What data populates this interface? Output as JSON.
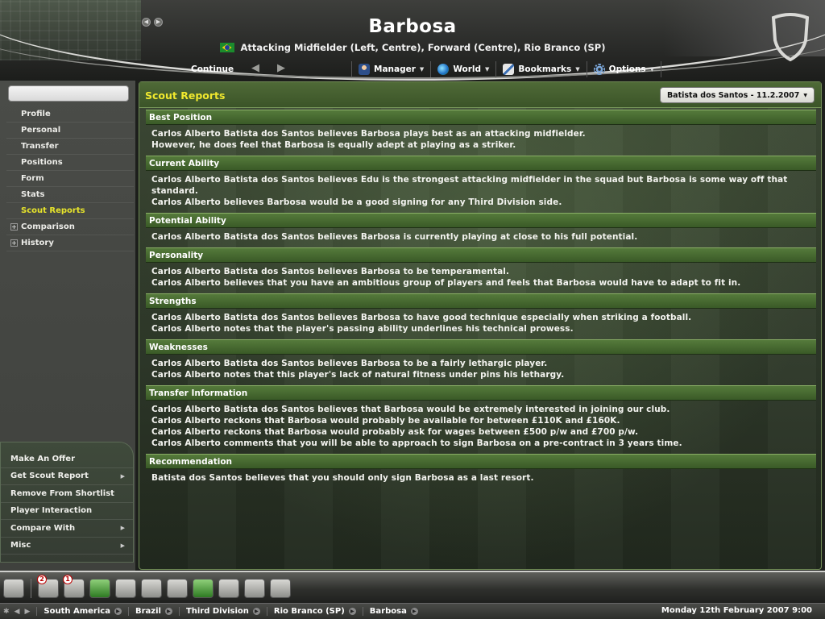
{
  "header": {
    "player_name": "Barbosa",
    "player_description": "Attacking Midfielder (Left, Centre), Forward (Centre), Rio Branco (SP)",
    "continue_label": "Continue",
    "menu": [
      {
        "label": "Manager",
        "icon": "manager-icon"
      },
      {
        "label": "World",
        "icon": "globe-icon"
      },
      {
        "label": "Bookmarks",
        "icon": "bookmark-icon"
      },
      {
        "label": "Options",
        "icon": "gear-icon"
      }
    ]
  },
  "sidebar": {
    "search_value": "",
    "items": [
      {
        "label": "Profile"
      },
      {
        "label": "Personal"
      },
      {
        "label": "Transfer"
      },
      {
        "label": "Positions"
      },
      {
        "label": "Form"
      },
      {
        "label": "Stats"
      },
      {
        "label": "Scout Reports"
      },
      {
        "label": "Comparison"
      },
      {
        "label": "History"
      }
    ],
    "actions": [
      {
        "label": "Make An Offer"
      },
      {
        "label": "Get Scout Report"
      },
      {
        "label": "Remove From Shortlist"
      },
      {
        "label": "Player Interaction"
      },
      {
        "label": "Compare With"
      },
      {
        "label": "Misc"
      }
    ]
  },
  "main": {
    "title": "Scout Reports",
    "scout_selector": "Batista dos Santos - 11.2.2007",
    "sections": [
      {
        "heading": "Best Position",
        "lines": [
          "Carlos Alberto Batista dos Santos believes Barbosa plays best as an attacking midfielder.",
          "However, he does feel that Barbosa is equally adept at playing as a striker."
        ]
      },
      {
        "heading": "Current Ability",
        "lines": [
          "Carlos Alberto Batista dos Santos believes Edu is the strongest attacking midfielder in the squad but Barbosa is some way off that standard.",
          "Carlos Alberto believes Barbosa would be a good signing for any Third Division side."
        ]
      },
      {
        "heading": "Potential Ability",
        "lines": [
          "Carlos Alberto Batista dos Santos believes Barbosa is currently playing at close to his full potential."
        ]
      },
      {
        "heading": "Personality",
        "lines": [
          "Carlos Alberto Batista dos Santos believes Barbosa to be temperamental.",
          "Carlos Alberto believes that you have an ambitious group of players and feels that Barbosa would have to adapt to fit in."
        ]
      },
      {
        "heading": "Strengths",
        "lines": [
          "Carlos Alberto Batista dos Santos believes Barbosa to have good technique especially when striking a football.",
          "Carlos Alberto notes that the player's passing ability underlines his technical prowess."
        ]
      },
      {
        "heading": "Weaknesses",
        "lines": [
          "Carlos Alberto Batista dos Santos believes Barbosa to be a fairly lethargic player.",
          "Carlos Alberto notes that this player's lack of natural fitness under pins his lethargy."
        ]
      },
      {
        "heading": "Transfer Information",
        "lines": [
          "Carlos Alberto Batista dos Santos believes that Barbosa would be extremely interested in joining our club.",
          "Carlos Alberto reckons that Barbosa would probably be available for between £110K and £160K.",
          "Carlos Alberto reckons that Barbosa would probably ask for wages between £500 p/w and £700 p/w.",
          "Carlos Alberto comments that you will be able to approach to sign Barbosa on a pre-contract in 3 years time."
        ]
      },
      {
        "heading": "Recommendation",
        "lines": [
          "Batista dos Santos believes that you should only sign Barbosa as a last resort."
        ]
      }
    ]
  },
  "dock": {
    "icons": [
      {
        "name": "home-icon",
        "badge": ""
      },
      {
        "name": "inbox-icon",
        "badge": "2"
      },
      {
        "name": "clock-icon",
        "badge": "1"
      },
      {
        "name": "tactics-icon",
        "badge": ""
      },
      {
        "name": "scouting-icon",
        "badge": ""
      },
      {
        "name": "trophy-icon",
        "badge": ""
      },
      {
        "name": "clipboard-icon",
        "badge": ""
      },
      {
        "name": "training-icon",
        "badge": ""
      },
      {
        "name": "binoculars-icon",
        "badge": ""
      },
      {
        "name": "notes-icon",
        "badge": ""
      },
      {
        "name": "chat-icon",
        "badge": ""
      }
    ]
  },
  "statusbar": {
    "breadcrumbs": [
      "South America",
      "Brazil",
      "Third Division",
      "Rio Branco (SP)",
      "Barbosa"
    ],
    "datetime": "Monday 12th February 2007 9:00"
  },
  "colors": {
    "accent_yellow": "#f0e82e",
    "section_green": "#557a3b",
    "panel_border": "#6f8a55"
  }
}
